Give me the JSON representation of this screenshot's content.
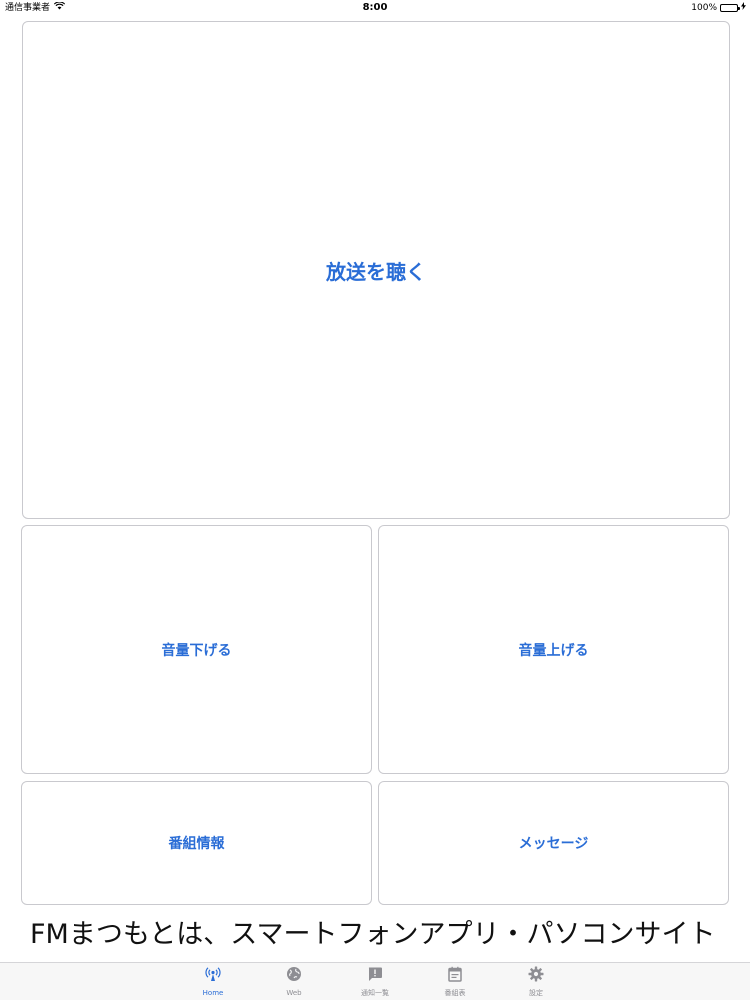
{
  "status_bar": {
    "carrier": "通信事業者",
    "time": "8:00",
    "battery_text": "100%",
    "battery_level": 1.0
  },
  "buttons": {
    "listen": "放送を聴く",
    "volume_down": "音量下げる",
    "volume_up": "音量上げる",
    "program_info": "番組情報",
    "message": "メッセージ"
  },
  "ticker": {
    "text": "FMまつもとは、スマートフォンアプリ・パソコンサイト"
  },
  "tabs": [
    {
      "label": "Home",
      "icon": "antenna-icon",
      "active": true
    },
    {
      "label": "Web",
      "icon": "globe-icon",
      "active": false
    },
    {
      "label": "通知一覧",
      "icon": "message-alert-icon",
      "active": false
    },
    {
      "label": "番組表",
      "icon": "schedule-icon",
      "active": false
    },
    {
      "label": "設定",
      "icon": "gear-icon",
      "active": false
    }
  ],
  "colors": {
    "accent": "#2a6dd6",
    "tab_inactive": "#8e8e93",
    "border": "#c9c9ce"
  }
}
